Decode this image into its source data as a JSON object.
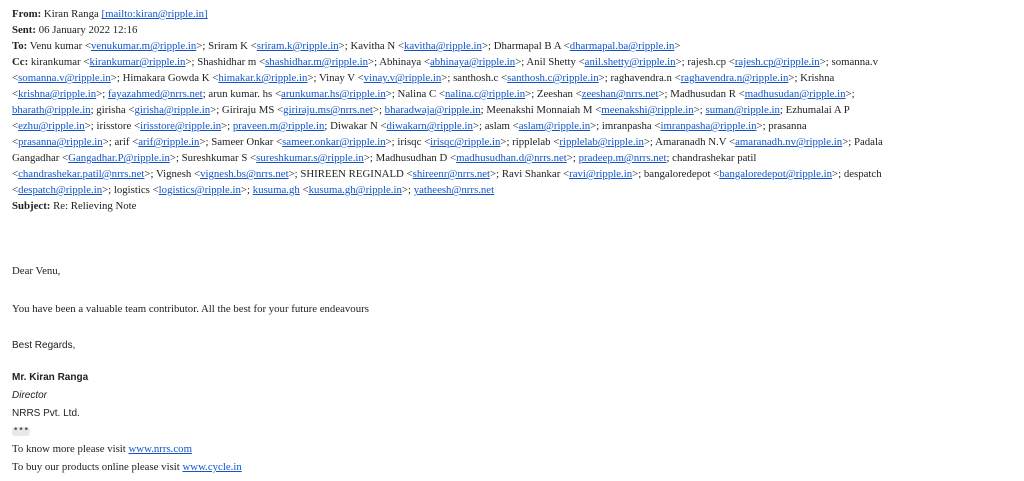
{
  "header": {
    "from_label": "From:",
    "from_name": "Kiran Ranga",
    "from_link": "[mailto:kiran@ripple.in]",
    "sent_label": "Sent:",
    "sent_value": "06 January 2022 12:16",
    "to_label": "To:",
    "to_recipients": [
      {
        "name": "Venu kumar",
        "email": "venukumar.m@ripple.in"
      },
      {
        "name": "Sriram K",
        "email": "sriram.k@ripple.in"
      },
      {
        "name": "Kavitha N",
        "email": "kavitha@ripple.in"
      },
      {
        "name": "Dharmapal B A",
        "email": "dharmapal.ba@ripple.in"
      }
    ],
    "cc_label": "Cc:",
    "cc_lines": [
      [
        {
          "t": "kirankumar <"
        },
        {
          "l": "kirankumar@ripple.in"
        },
        {
          "t": ">; Shashidhar m <"
        },
        {
          "l": "shashidhar.m@ripple.in"
        },
        {
          "t": ">; Abhinaya <"
        },
        {
          "l": "abhinaya@ripple.in"
        },
        {
          "t": ">; Anil Shetty <"
        },
        {
          "l": "anil.shetty@ripple.in"
        },
        {
          "t": ">; rajesh.cp <"
        },
        {
          "l": "rajesh.cp@ripple.in"
        },
        {
          "t": ">; somanna.v"
        }
      ],
      [
        {
          "t": "<"
        },
        {
          "l": "somanna.v@ripple.in"
        },
        {
          "t": ">; Himakara Gowda K <"
        },
        {
          "l": "himakar.k@ripple.in"
        },
        {
          "t": ">; Vinay V <"
        },
        {
          "l": "vinay.v@ripple.in"
        },
        {
          "t": ">; santhosh.c <"
        },
        {
          "l": "santhosh.c@ripple.in"
        },
        {
          "t": ">; raghavendra.n <"
        },
        {
          "l": "raghavendra.n@ripple.in"
        },
        {
          "t": ">; Krishna"
        }
      ],
      [
        {
          "t": "<"
        },
        {
          "l": "krishna@ripple.in"
        },
        {
          "t": ">; "
        },
        {
          "l": "fayazahmed@nrrs.net"
        },
        {
          "t": "; arun kumar. hs <"
        },
        {
          "l": "arunkumar.hs@ripple.in"
        },
        {
          "t": ">; Nalina C <"
        },
        {
          "l": "nalina.c@ripple.in"
        },
        {
          "t": ">; Zeeshan <"
        },
        {
          "l": "zeeshan@nrrs.net"
        },
        {
          "t": ">; Madhusudan R <"
        },
        {
          "l": "madhusudan@ripple.in"
        },
        {
          "t": ">;"
        }
      ],
      [
        {
          "l": "bharath@ripple.in"
        },
        {
          "t": "; girisha <"
        },
        {
          "l": "girisha@ripple.in"
        },
        {
          "t": ">; Giriraju MS <"
        },
        {
          "l": "giriraju.ms@nrrs.net"
        },
        {
          "t": ">; "
        },
        {
          "l": "bharadwaja@ripple.in"
        },
        {
          "t": "; Meenakshi Monnaiah M <"
        },
        {
          "l": "meenakshi@ripple.in"
        },
        {
          "t": ">; "
        },
        {
          "l": "suman@ripple.in"
        },
        {
          "t": "; Ezhumalai A P"
        }
      ],
      [
        {
          "t": "<"
        },
        {
          "l": "ezhu@ripple.in"
        },
        {
          "t": ">; irisstore <"
        },
        {
          "l": "irisstore@ripple.in"
        },
        {
          "t": ">; "
        },
        {
          "l": "praveen.m@ripple.in"
        },
        {
          "t": "; Diwakar N <"
        },
        {
          "l": "diwakarn@ripple.in"
        },
        {
          "t": ">; aslam <"
        },
        {
          "l": "aslam@ripple.in"
        },
        {
          "t": ">; imranpasha <"
        },
        {
          "l": "imranpasha@ripple.in"
        },
        {
          "t": ">; prasanna"
        }
      ],
      [
        {
          "t": "<"
        },
        {
          "l": "prasanna@ripple.in"
        },
        {
          "t": ">; arif <"
        },
        {
          "l": "arif@ripple.in"
        },
        {
          "t": ">; Sameer Onkar <"
        },
        {
          "l": "sameer.onkar@ripple.in"
        },
        {
          "t": ">; irisqc <"
        },
        {
          "l": "irisqc@ripple.in"
        },
        {
          "t": ">; ripplelab <"
        },
        {
          "l": "ripplelab@ripple.in"
        },
        {
          "t": ">; Amaranadh N.V <"
        },
        {
          "l": "amaranadh.nv@ripple.in"
        },
        {
          "t": ">; Padala"
        }
      ],
      [
        {
          "t": "Gangadhar <"
        },
        {
          "l": "Gangadhar.P@ripple.in"
        },
        {
          "t": ">; Sureshkumar S <"
        },
        {
          "l": "sureshkumar.s@ripple.in"
        },
        {
          "t": ">; Madhusudhan D <"
        },
        {
          "l": "madhusudhan.d@nrrs.net"
        },
        {
          "t": ">; "
        },
        {
          "l": "pradeep.m@nrrs.net"
        },
        {
          "t": "; chandrashekar patil"
        }
      ],
      [
        {
          "t": "<"
        },
        {
          "l": "chandrashekar.patil@nrrs.net"
        },
        {
          "t": ">; Vignesh <"
        },
        {
          "l": "vignesh.bs@nrrs.net"
        },
        {
          "t": ">; SHIREEN REGINALD <"
        },
        {
          "l": "shireenr@nrrs.net"
        },
        {
          "t": ">; Ravi Shankar <"
        },
        {
          "l": "ravi@ripple.in"
        },
        {
          "t": ">; bangaloredepot <"
        },
        {
          "l": "bangaloredepot@ripple.in"
        },
        {
          "t": ">; despatch"
        }
      ],
      [
        {
          "t": "<"
        },
        {
          "l": "despatch@ripple.in"
        },
        {
          "t": ">; logistics <"
        },
        {
          "l": "logistics@ripple.in"
        },
        {
          "t": ">; "
        },
        {
          "l": "kusuma.gh"
        },
        {
          "t": " <"
        },
        {
          "l": "kusuma.gh@ripple.in"
        },
        {
          "t": ">; "
        },
        {
          "l": "yatheesh@nrrs.net"
        }
      ]
    ],
    "subject_label": "Subject:",
    "subject_value": "Re: Relieving Note"
  },
  "body": {
    "greeting": "Dear Venu,",
    "message": "You have been a valuable team contributor. All the best for your future endeavours",
    "regards": "Best Regards,"
  },
  "signature": {
    "name": "Mr. Kiran Ranga",
    "title": "Director",
    "company": "NRRS Pvt. Ltd.",
    "ellipsis": "•••",
    "visit1_text": "To know more please visit ",
    "visit1_link": "www.nrrs.com",
    "visit2_text": "To buy our products online please visit ",
    "visit2_link": "www.cycle.in"
  },
  "colors": {
    "link": "#1155cc",
    "text": "#222222"
  }
}
